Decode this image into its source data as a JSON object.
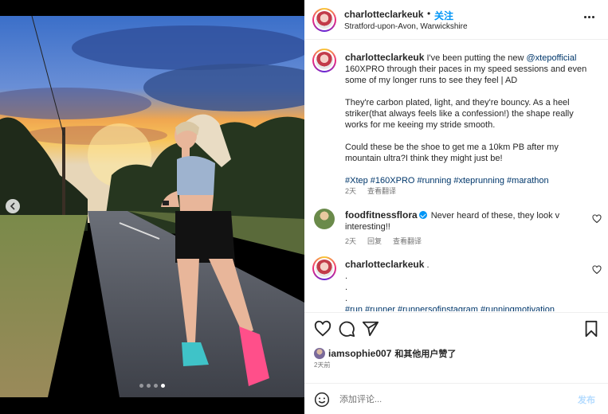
{
  "post": {
    "username": "charlotteclarkeuk",
    "separator": "•",
    "follow_label": "关注",
    "location": "Stratford-upon-Avon, Warwickshire"
  },
  "caption": {
    "username": "charlotteclarkeuk",
    "p1_before": "I've been putting the new ",
    "p1_mention": "@xtepofficial",
    "p1_after": " 160XPRO through their paces in my speed sessions and even some of my longer runs to see they feel | AD",
    "p2": "They're carbon plated, light, and they're bouncy. As a heel striker(that always feels like a confession!) the shape really works for me keeing my stride smooth.",
    "p3": "Could these be the shoe to get me a 10km PB after my mountain ultra?I think they might just be!",
    "hashtags": "#Xtep #160XPRO #running #xteprunning #marathon",
    "time": "2天",
    "translate": "查看翻译"
  },
  "comment1": {
    "username": "foodfitnessflora",
    "text": "Never heard of these, they look v interesting!!",
    "time": "2天",
    "reply": "回复",
    "translate": "查看翻译"
  },
  "comment2": {
    "username": "charlotteclarkeuk",
    "text": ".",
    "line_dots": ".",
    "hashtags": "#run #runner #runnersofinstagram #runningmotivation"
  },
  "likes": {
    "user": "iamsophie007",
    "suffix": "和其他用户赞了",
    "time_ago": "2天前"
  },
  "composer": {
    "placeholder": "添加评论...",
    "post_label": "发布"
  },
  "carousel": {
    "count": 4,
    "active_index": 3
  },
  "colors": {
    "accent": "#0095f6",
    "link": "#00376b",
    "muted": "#737373"
  },
  "icons": [
    "chevron-left-icon",
    "more-icon",
    "heart-icon",
    "comment-icon",
    "share-icon",
    "bookmark-icon",
    "emoji-icon",
    "verified-icon"
  ]
}
